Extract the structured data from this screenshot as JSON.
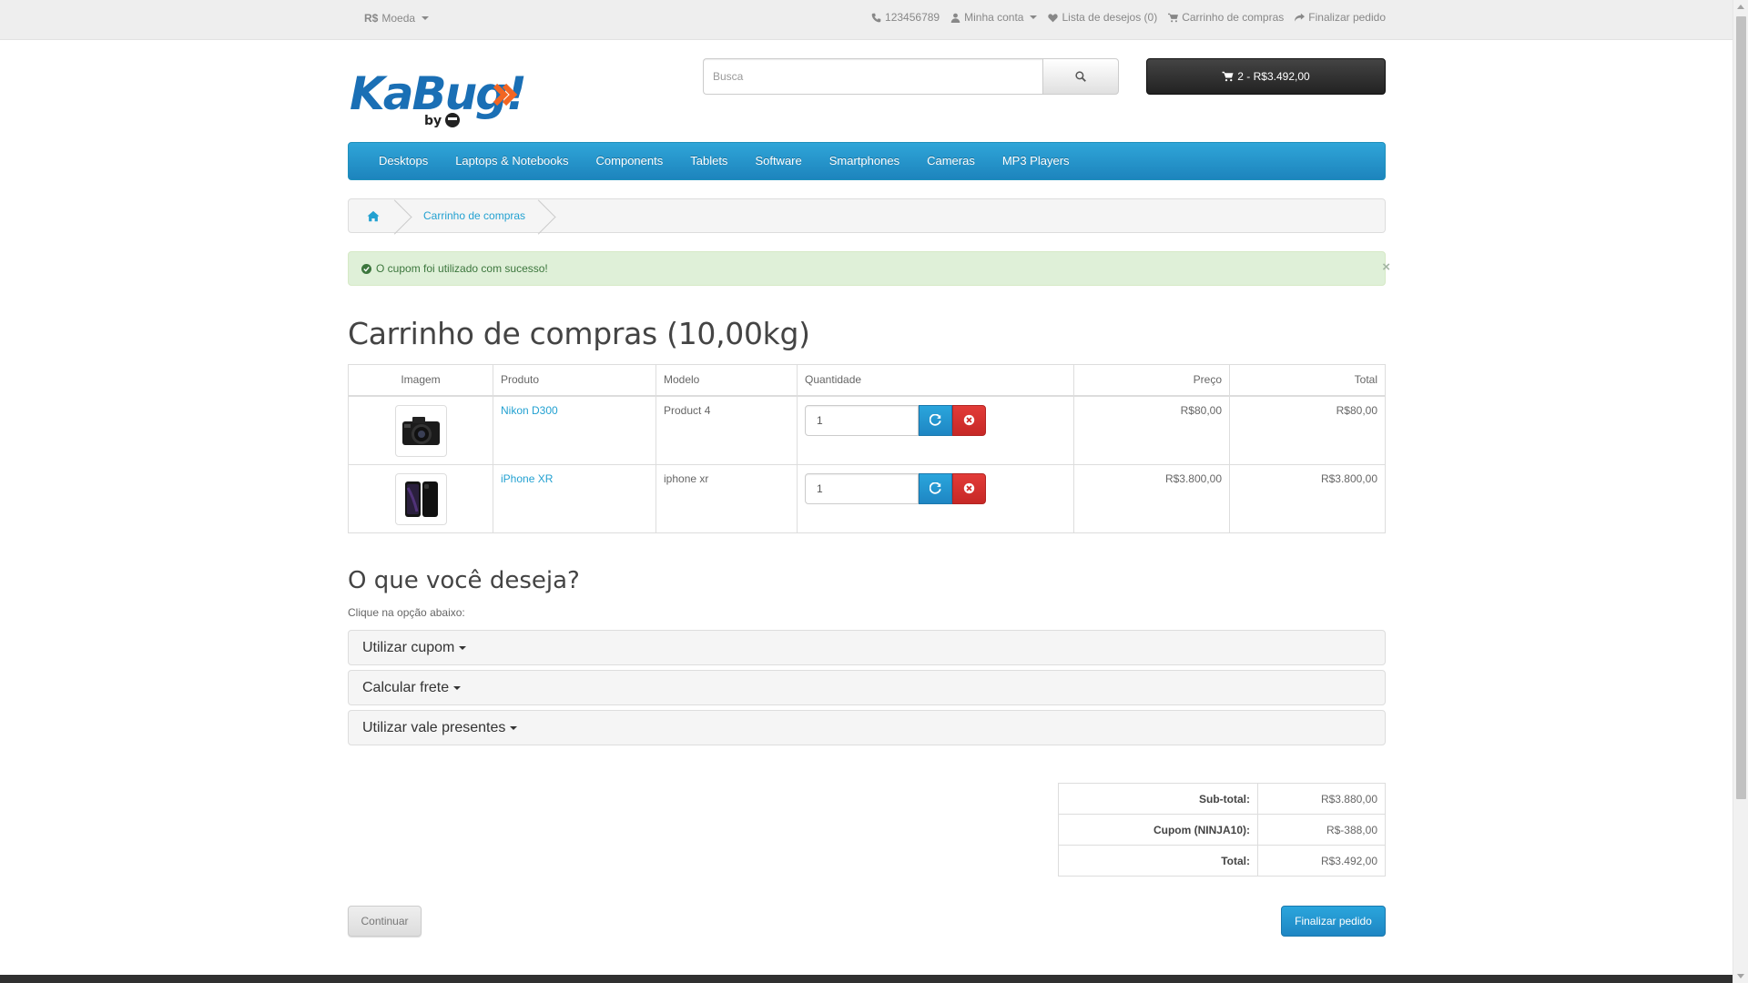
{
  "topbar": {
    "currency_symbol": "R$",
    "currency_label": "Moeda",
    "phone": "123456789",
    "account": "Minha conta",
    "wishlist": "Lista de desejos (0)",
    "cart": "Carrinho de compras",
    "checkout": "Finalizar pedido"
  },
  "header": {
    "logo_text": "KaBug!",
    "logo_sub": "by",
    "search_placeholder": "Busca",
    "cart_button": "2 - R$3.492,00"
  },
  "menu": [
    "Desktops",
    "Laptops & Notebooks",
    "Components",
    "Tablets",
    "Software",
    "Smartphones",
    "Cameras",
    "MP3 Players"
  ],
  "breadcrumb": {
    "current": "Carrinho de compras"
  },
  "alert": {
    "message": "O cupom foi utilizado com sucesso!",
    "close": "×"
  },
  "page_title": "Carrinho de compras  (10,00kg)",
  "cart_table": {
    "headers": [
      "Imagem",
      "Produto",
      "Modelo",
      "Quantidade",
      "Preço",
      "Total"
    ],
    "rows": [
      {
        "product": "Nikon D300",
        "model": "Product 4",
        "quantity": "1",
        "price": "R$80,00",
        "total": "R$80,00"
      },
      {
        "product": "iPhone XR",
        "model": "iphone xr",
        "quantity": "1",
        "price": "R$3.800,00",
        "total": "R$3.800,00"
      }
    ]
  },
  "options": {
    "title": "O que você deseja?",
    "hint": "Clique na opção abaixo:",
    "panels": [
      "Utilizar cupom",
      "Calcular frete",
      "Utilizar vale presentes"
    ]
  },
  "totals": [
    {
      "label": "Sub-total:",
      "value": "R$3.880,00"
    },
    {
      "label": "Cupom (NINJA10):",
      "value": "R$-388,00"
    },
    {
      "label": "Total:",
      "value": "R$3.492,00"
    }
  ],
  "buttons": {
    "continue": "Continuar",
    "checkout": "Finalizar pedido"
  },
  "colors": {
    "accent": "#229ac8",
    "danger": "#da4f49",
    "success_bg": "#dff0d8",
    "logo_blue": "#1a6fb5",
    "logo_orange": "#f26522"
  }
}
